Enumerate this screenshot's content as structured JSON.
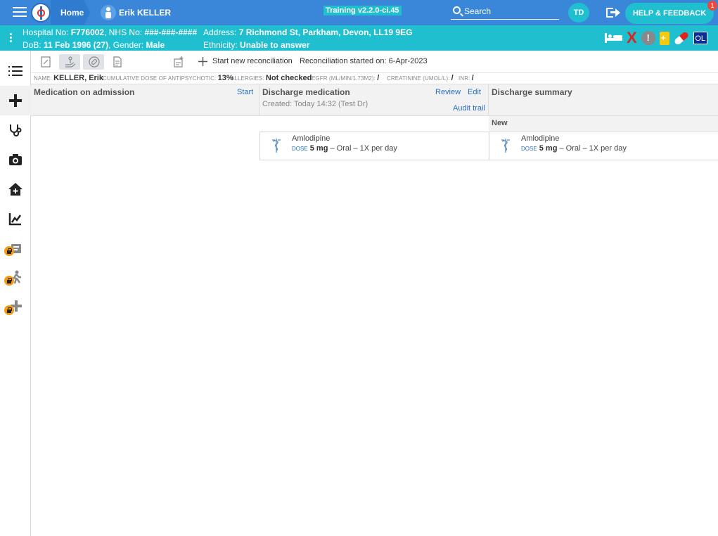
{
  "header": {
    "home_label": "Home",
    "patient_name": "Erik KELLER",
    "training_label": "Training v2.2.0-ci.45",
    "search_label": "Search",
    "user_initials": "TD",
    "help_label": "HELP & FEEDBACK",
    "help_badge_count": "1"
  },
  "patient_banner": {
    "hospital_no_label": "Hospital No:",
    "hospital_no": "F776002",
    "nhs_no_label": ", NHS No:",
    "nhs_no": "###-###-####",
    "address_label": "Address:",
    "address": "7 Richmond St, Parkham, Devon, LL19 9EG",
    "dob_label": "DoB:",
    "dob": "11 Feb 1996 (27)",
    "gender_label": ", Gender:",
    "gender": "Male",
    "ethnicity_label": "Ethnicity:",
    "ethnicity": "Unable to answer",
    "ol_label": "OL",
    "alert_symbol": "!",
    "x_symbol": "X"
  },
  "toolbar": {
    "start_reconciliation": "Start new reconciliation",
    "reconciliation_started": "Reconciliation started on: 6-Apr-2023"
  },
  "infobar": {
    "name_key": "NAME:",
    "name_val": "KELLER, Erik",
    "antipsychotic_key": "CUMULATIVE DOSE OF ANTIPSYCHOTIC:",
    "antipsychotic_val": "13%",
    "allergies_key": "ALLERGIES:",
    "allergies_val": "Not checked",
    "egfr_key": "EGFR (ML/MIN/1.73M2):",
    "egfr_val": "/",
    "creatinine_key": "CREATININE (UMOL/L):",
    "creatinine_val": "/",
    "inr_key": "INR:",
    "inr_val": "/"
  },
  "columns": {
    "admission": {
      "title": "Medication on admission",
      "start_link": "Start"
    },
    "discharge": {
      "title": "Discharge medication",
      "review_link": "Review",
      "edit_link": "Edit",
      "created": "Created: Today 14:32 (Test Dr)",
      "audit_link": "Audit trail"
    },
    "summary": {
      "title": "Discharge summary",
      "new_label": "New"
    }
  },
  "medications": {
    "discharge": {
      "name": "Amlodipine",
      "dose_key": "DOSE",
      "dose": "5 mg",
      "route": "– Oral – 1X per day"
    },
    "summary": {
      "name": "Amlodipine",
      "dose_key": "DOSE",
      "dose": "5 mg",
      "route": "– Oral – 1X per day"
    }
  }
}
